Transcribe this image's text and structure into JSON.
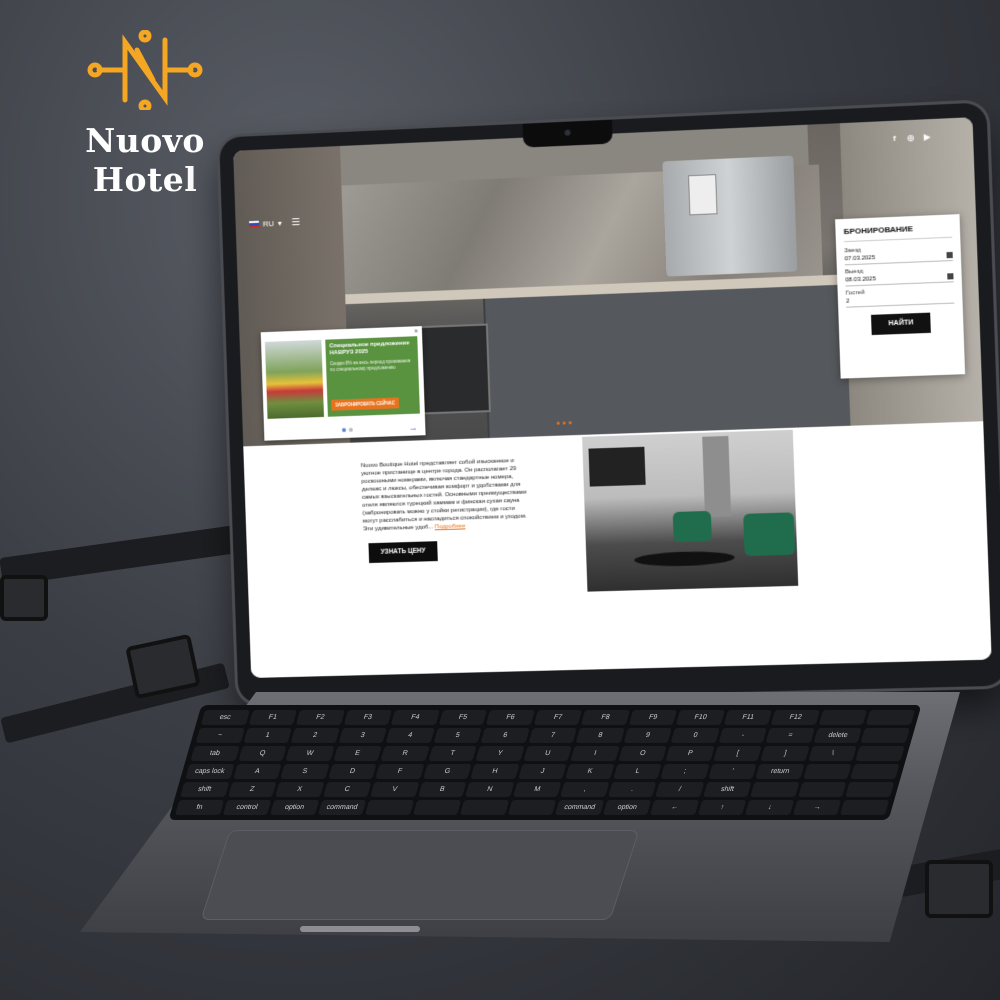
{
  "brand": {
    "name": "Nuovo Hotel",
    "logo_color": "#F5A623"
  },
  "site": {
    "language": "RU",
    "menu_icon": "hamburger-icon",
    "socials": [
      "facebook-icon",
      "instagram-icon",
      "youtube-icon"
    ],
    "promo": {
      "title": "Специальное предложение НАВРУЗ 2025",
      "text": "Скидки 8% на весь период проживания по специальному предложению",
      "button": "ЗАБРОНИРОВАТЬ СЕЙЧАС",
      "close": "×",
      "arrow": "→"
    },
    "booking": {
      "title": "БРОНИРОВАНИЕ",
      "checkin_label": "Заезд",
      "checkin_value": "07.03.2025",
      "checkout_label": "Выезд",
      "checkout_value": "08.03.2025",
      "guests_label": "Гостей",
      "guests_value": "2",
      "submit": "НАЙТИ"
    },
    "about": {
      "text": "Nuovo Boutique Hotel представляет собой изысканное и уютное пристанище в центре города. Он располагает 29 роскошными номерами, включая стандартные номера, делюкс и люксы, обеспечивая комфорт и удобствами для самых взыскательных гостей. Основными преимуществами отеля являются турецкий хаммам и финская сухая сауна (забронировать можно у стойки регистрации), где гости могут расслабиться и насладиться спокойствием и уходом. Эти удивительные удоб...",
      "more": "Подробнее",
      "price_button": "УЗНАТЬ ЦЕНУ"
    }
  },
  "keyboard": {
    "keys": [
      "esc",
      "F1",
      "F2",
      "F3",
      "F4",
      "F5",
      "F6",
      "F7",
      "F8",
      "F9",
      "F10",
      "F11",
      "F12",
      "",
      "",
      "~",
      "1",
      "2",
      "3",
      "4",
      "5",
      "6",
      "7",
      "8",
      "9",
      "0",
      "-",
      "=",
      "delete",
      "",
      "tab",
      "Q",
      "W",
      "E",
      "R",
      "T",
      "Y",
      "U",
      "I",
      "O",
      "P",
      "[",
      "]",
      "\\",
      "",
      "caps lock",
      "A",
      "S",
      "D",
      "F",
      "G",
      "H",
      "J",
      "K",
      "L",
      ";",
      "'",
      "return",
      "",
      "",
      "shift",
      "Z",
      "X",
      "C",
      "V",
      "B",
      "N",
      "M",
      ",",
      ".",
      "/",
      "shift",
      "",
      "",
      "",
      "fn",
      "control",
      "option",
      "command",
      "",
      "",
      "",
      "",
      "command",
      "option",
      "←",
      "↑",
      "↓",
      "→",
      ""
    ]
  }
}
